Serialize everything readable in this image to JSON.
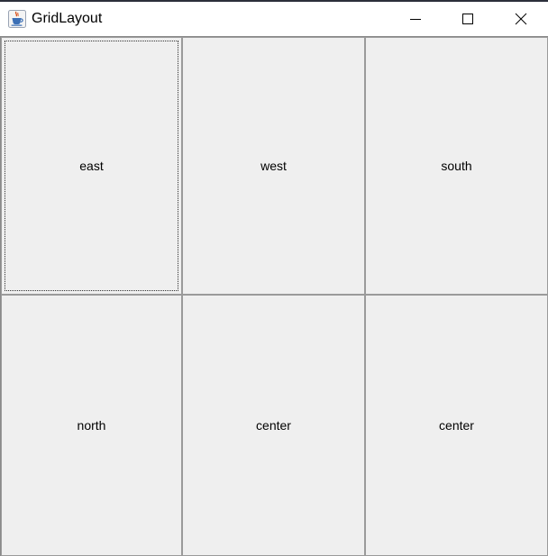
{
  "window": {
    "title": "GridLayout",
    "app_icon": "java-coffee-cup-icon",
    "controls": {
      "minimize_icon": "minimize-icon",
      "maximize_icon": "maximize-icon",
      "close_icon": "close-icon"
    }
  },
  "grid": {
    "rows": 2,
    "columns": 3,
    "buttons": [
      {
        "label": "east",
        "focused": true
      },
      {
        "label": "west",
        "focused": false
      },
      {
        "label": "south",
        "focused": false
      },
      {
        "label": "north",
        "focused": false
      },
      {
        "label": "center",
        "focused": false
      },
      {
        "label": "center",
        "focused": false
      }
    ]
  },
  "colors": {
    "button_background": "#efefef",
    "grid_line": "#8a8a8a",
    "titlebar_background": "#ffffff",
    "text": "#000000"
  }
}
